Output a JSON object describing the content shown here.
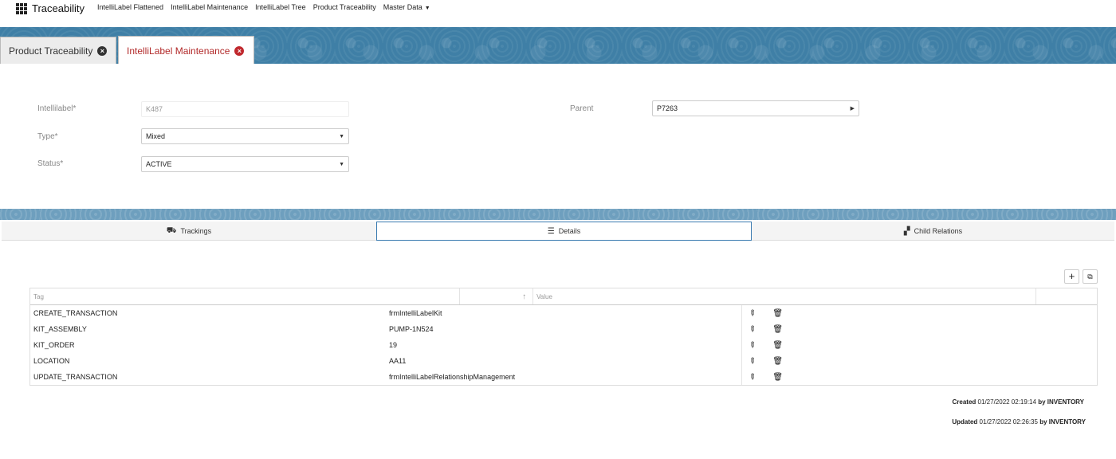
{
  "app": {
    "title": "Traceability"
  },
  "nav": {
    "links": [
      "IntelliLabel Flattened",
      "IntelliLabel Maintenance",
      "IntelliLabel Tree",
      "Product Traceability"
    ],
    "master_data": "Master Data"
  },
  "tabs": [
    {
      "label": "Product Traceability"
    },
    {
      "label": "IntelliLabel Maintenance"
    }
  ],
  "form": {
    "intellilabel": {
      "label": "Intellilabel*",
      "value": "K487"
    },
    "type": {
      "label": "Type*",
      "value": "Mixed"
    },
    "status": {
      "label": "Status*",
      "value": "ACTIVE"
    },
    "parent": {
      "label": "Parent",
      "value": "P7263"
    }
  },
  "subtabs": [
    {
      "label": "Trackings",
      "icon": "trucks-icon"
    },
    {
      "label": "Details",
      "icon": "list-icon"
    },
    {
      "label": "Child Relations",
      "icon": "boxes-icon"
    }
  ],
  "table": {
    "headers": {
      "tag": "Tag",
      "value": "Value"
    },
    "rows": [
      {
        "tag": "CREATE_TRANSACTION",
        "value": "frmIntelliLabelKit"
      },
      {
        "tag": "KIT_ASSEMBLY",
        "value": "PUMP-1N524"
      },
      {
        "tag": "KIT_ORDER",
        "value": "19"
      },
      {
        "tag": "LOCATION",
        "value": "AA11"
      },
      {
        "tag": "UPDATE_TRANSACTION",
        "value": "frmIntelliLabelRelationshipManagement"
      }
    ]
  },
  "meta": {
    "created_label": "Created",
    "created_value": "01/27/2022 02:19:14",
    "by": "by",
    "created_user": "INVENTORY",
    "updated_label": "Updated",
    "updated_value": "01/27/2022 02:26:35",
    "updated_user": "INVENTORY"
  },
  "colors": {
    "accent": "#3a7bb0",
    "banner": "#3f7fa6",
    "close_red": "#c0282d"
  }
}
